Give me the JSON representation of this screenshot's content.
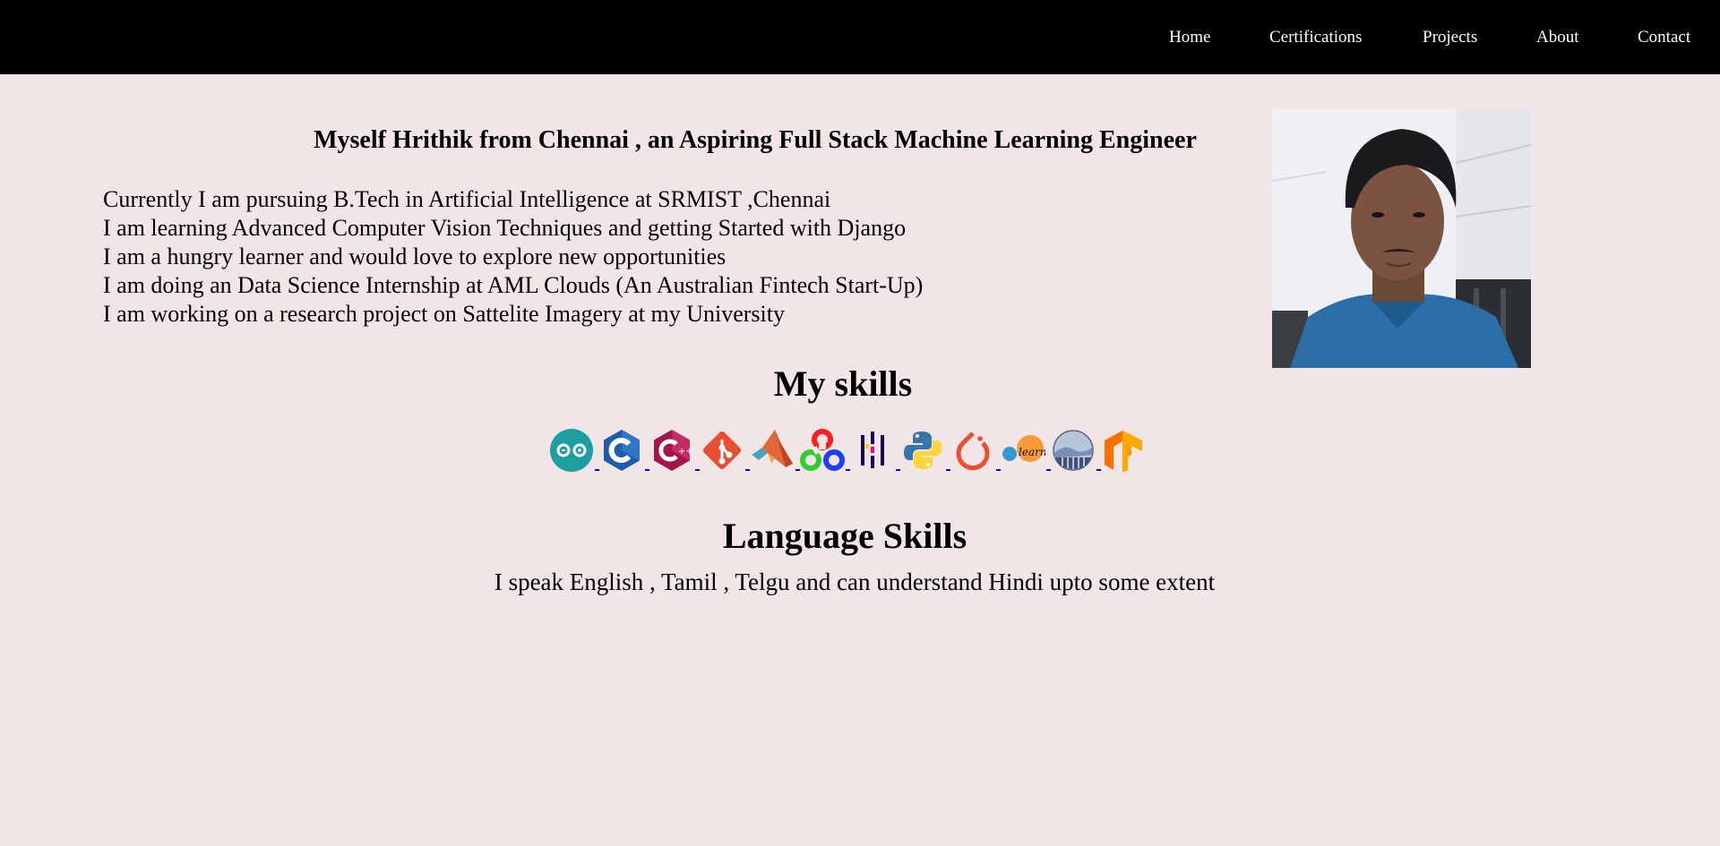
{
  "nav": {
    "items": [
      {
        "label": "Home"
      },
      {
        "label": "Certifications"
      },
      {
        "label": "Projects"
      },
      {
        "label": "About"
      },
      {
        "label": "Contact"
      }
    ]
  },
  "intro": {
    "headline": "Myself Hrithik from Chennai , an Aspiring Full Stack Machine Learning Engineer",
    "lines": [
      "Currently I am pursuing B.Tech in Artificial Intelligence at SRMIST ,Chennai",
      "I am learning Advanced Computer Vision Techniques and getting Started with Django",
      "I am a hungry learner and would love to explore new opportunities",
      "I am doing an Data Science Internship at AML Clouds (An Australian Fintech Start-Up)",
      "I am working on a research project on Sattelite Imagery at my University"
    ]
  },
  "skills": {
    "title": "My skills",
    "icons": [
      "arduino-icon",
      "c-icon",
      "cplusplus-icon",
      "git-icon",
      "matlab-icon",
      "opencv-icon",
      "pandas-icon",
      "python-icon",
      "pytorch-icon",
      "scikit-learn-icon",
      "seaborn-icon",
      "tensorflow-icon"
    ]
  },
  "languages": {
    "title": "Language Skills",
    "text": "I speak English , Tamil , Telgu and can understand Hindi upto some extent"
  },
  "colors": {
    "background": "#f2e5e6",
    "navbar": "#000000",
    "nav_text": "#ffffff",
    "link_underline": "#0000ee"
  }
}
